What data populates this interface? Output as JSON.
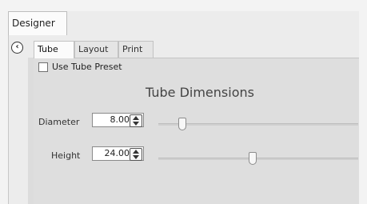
{
  "outer_tabs": {
    "designer_label": "Designer"
  },
  "inner_tabs": [
    {
      "label": "Tube"
    },
    {
      "label": "Layout"
    },
    {
      "label": "Print"
    }
  ],
  "use_tube_preset": {
    "label": "Use Tube Preset",
    "checked": false
  },
  "section": {
    "title": "Tube Dimensions"
  },
  "fields": {
    "diameter": {
      "label": "Diameter",
      "value": "8.00",
      "slider_fraction": 0.12
    },
    "height": {
      "label": "Height",
      "value": "24.00",
      "slider_fraction": 0.47
    }
  }
}
